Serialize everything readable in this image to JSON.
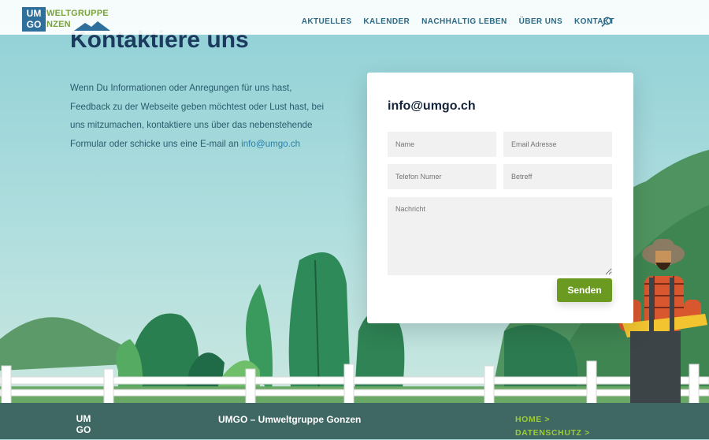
{
  "header": {
    "logo": {
      "box_line1": "UM",
      "box_line2": "GO",
      "text_line1": "WELTGRUPPE",
      "text_line2": "NZEN"
    },
    "nav": [
      {
        "label": "AKTUELLES"
      },
      {
        "label": "KALENDER"
      },
      {
        "label": "NACHHALTIG LEBEN"
      },
      {
        "label": "ÜBER UNS"
      },
      {
        "label": "KONTAKT"
      }
    ],
    "search_icon": "search-icon"
  },
  "main": {
    "title": "Kontaktiere uns",
    "intro_text": "Wenn Du Informationen oder Anregungen für uns hast, Feedback zu der Webseite geben möchtest oder Lust hast, bei uns mitzumachen, kontaktiere uns über das nebenstehende Formular oder schicke uns eine E-mail an ",
    "intro_link": "info@umgo.ch"
  },
  "form": {
    "title": "info@umgo.ch",
    "name_placeholder": "Name",
    "email_placeholder": "Email Adresse",
    "phone_placeholder": "Telefon Numer",
    "subject_placeholder": "Betreff",
    "message_placeholder": "Nachricht",
    "submit_label": "Senden",
    "accent_color": "#6a9a1f"
  },
  "footer": {
    "logo_line1": "UM",
    "logo_line2": "GO",
    "title": "UMGO – Umweltgruppe Gonzen",
    "links": [
      {
        "label": "HOME >"
      },
      {
        "label": "DATENSCHUTZ >"
      }
    ]
  }
}
